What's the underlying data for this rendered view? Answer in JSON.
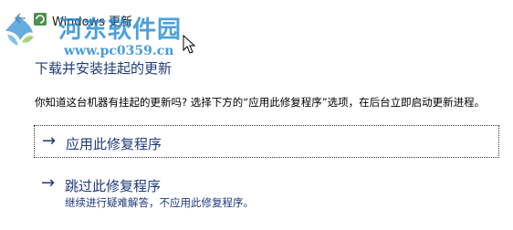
{
  "titlebar": {
    "window_title": "Windows 更新"
  },
  "watermark": {
    "name": "河东软件园",
    "url": "www.pc0359.cn"
  },
  "content": {
    "heading": "下载并安装挂起的更新",
    "description": "你知道这台机器有挂起的更新吗? 选择下方的“应用此修复程序”选项，在后台立即启动更新进程。",
    "options": [
      {
        "arrow": "→",
        "label": "应用此修复程序"
      },
      {
        "arrow": "→",
        "label": "跳过此修复程序",
        "sublabel": "继续进行疑难解答，不应用此修复程序。"
      }
    ]
  },
  "colors": {
    "accent": "#1f3a7a",
    "watermark": "#1d86d0",
    "background": "#ffffff"
  },
  "icons": {
    "back": "back-arrow-icon",
    "app": "windows-update-icon",
    "cursor": "mouse-cursor-icon",
    "logo": "watermark-logo-icon"
  }
}
